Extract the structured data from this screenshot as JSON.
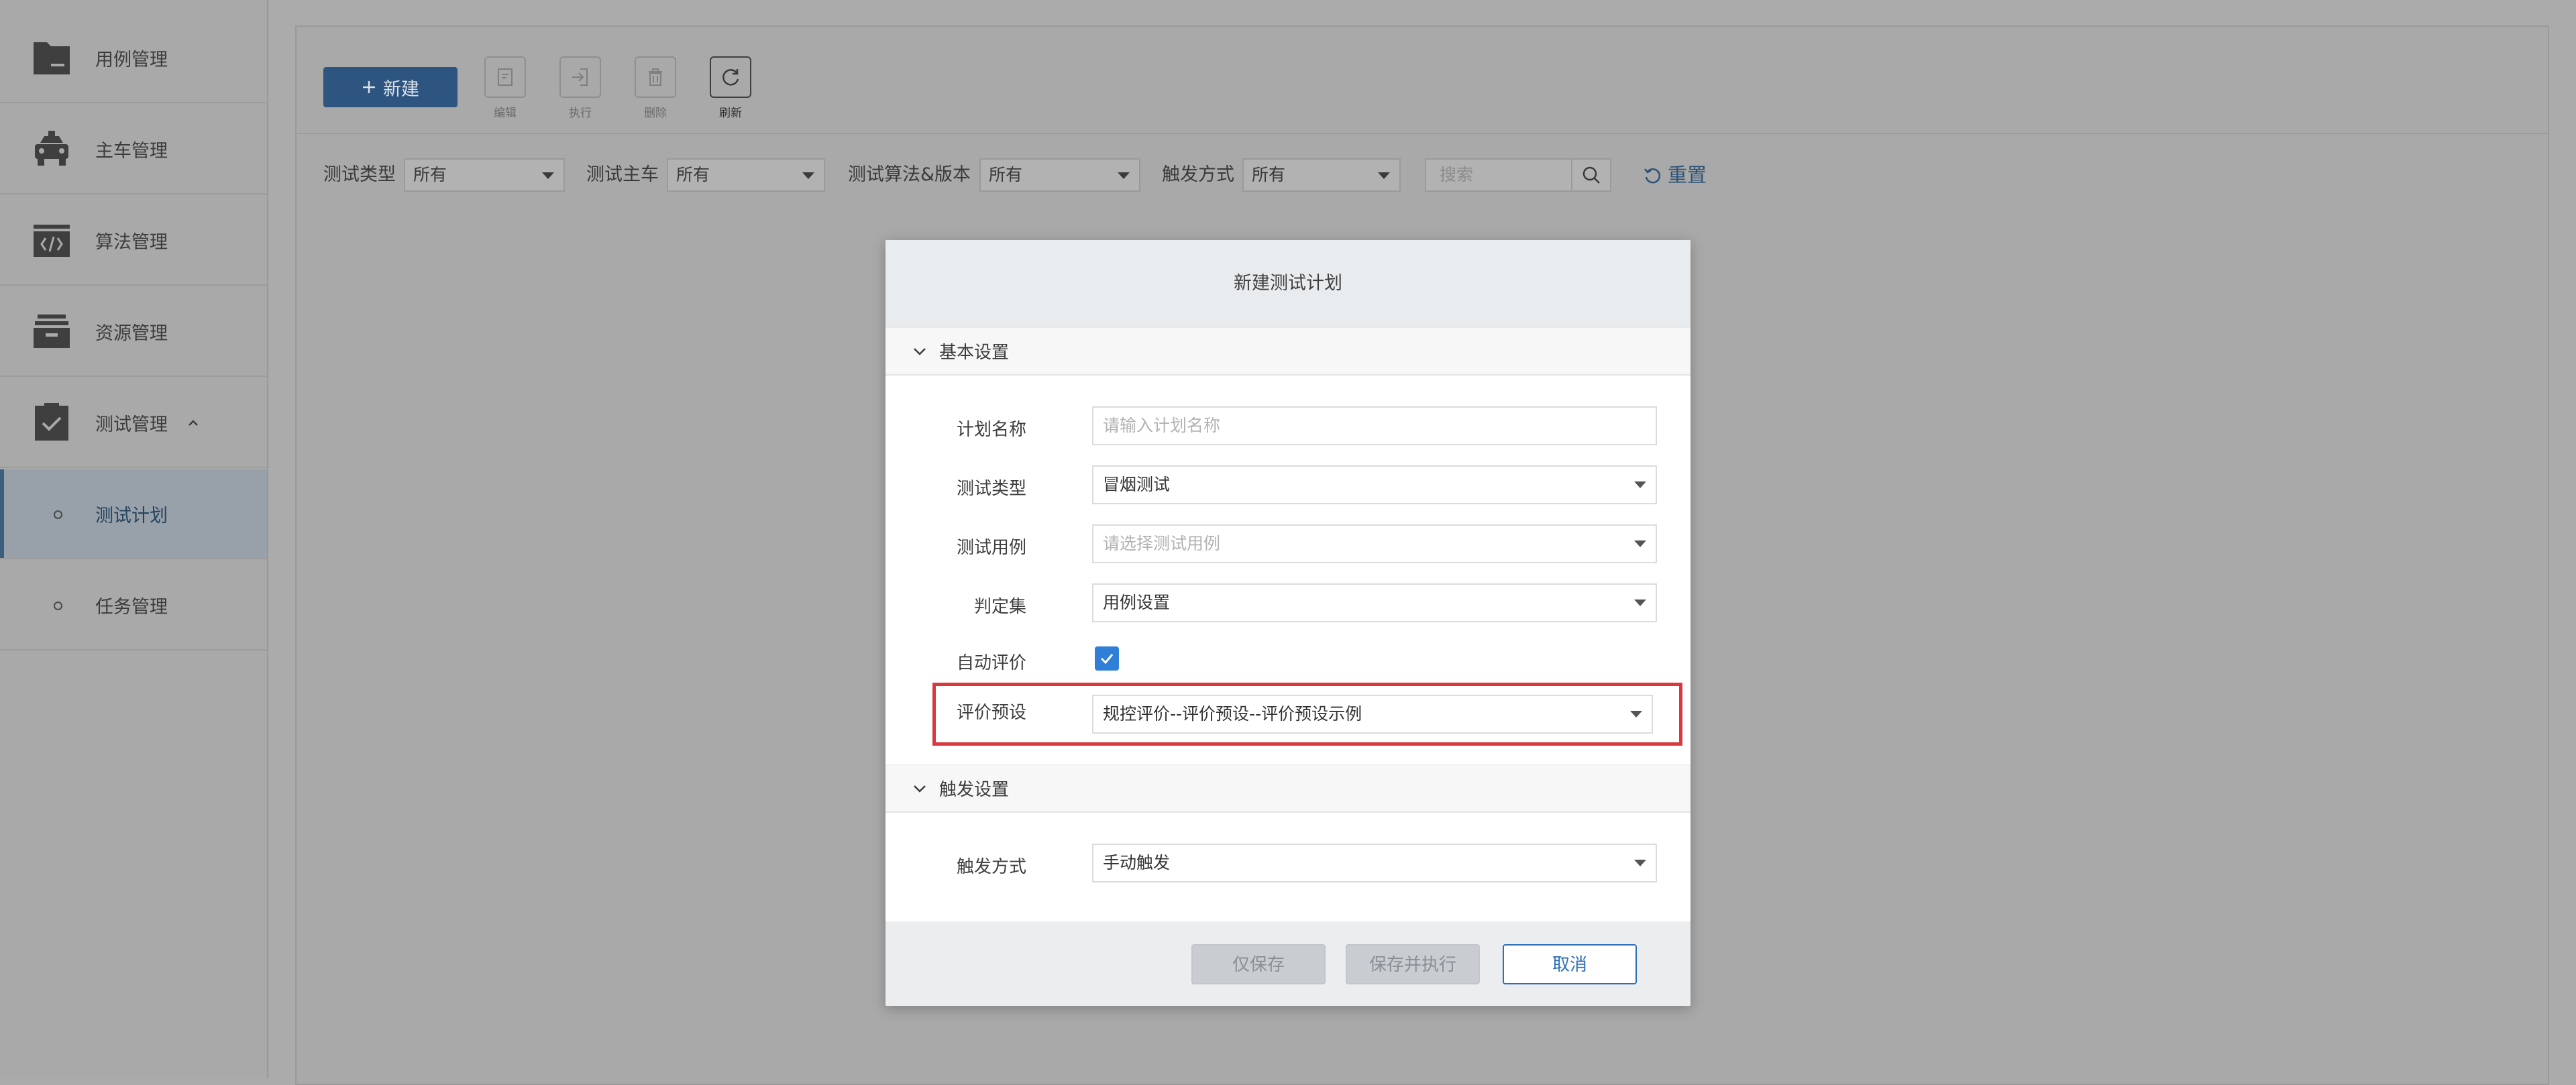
{
  "sidebar": {
    "items": [
      {
        "label": "用例管理",
        "icon": "folder-icon"
      },
      {
        "label": "主车管理",
        "icon": "car-icon"
      },
      {
        "label": "算法管理",
        "icon": "code-icon"
      },
      {
        "label": "资源管理",
        "icon": "archive-icon"
      },
      {
        "label": "测试管理",
        "icon": "clipboard-check-icon",
        "expanded": true
      }
    ],
    "subitems": [
      {
        "label": "测试计划",
        "active": true
      },
      {
        "label": "任务管理",
        "active": false
      }
    ]
  },
  "toolbar": {
    "new_label": "新建",
    "tools": [
      {
        "label": "编辑",
        "icon": "edit-icon"
      },
      {
        "label": "执行",
        "icon": "execute-icon"
      },
      {
        "label": "删除",
        "icon": "trash-icon"
      },
      {
        "label": "刷新",
        "icon": "refresh-icon"
      }
    ]
  },
  "filters": {
    "test_type": {
      "label": "测试类型",
      "value": "所有"
    },
    "test_vehicle": {
      "label": "测试主车",
      "value": "所有"
    },
    "algorithm": {
      "label": "测试算法&版本",
      "value": "所有"
    },
    "trigger": {
      "label": "触发方式",
      "value": "所有"
    },
    "search_placeholder": "搜索",
    "reset_label": "重置"
  },
  "modal": {
    "title": "新建测试计划",
    "basic_section": "基本设置",
    "fields": {
      "plan_name": {
        "label": "计划名称",
        "placeholder": "请输入计划名称"
      },
      "test_type": {
        "label": "测试类型",
        "value": "冒烟测试"
      },
      "test_case": {
        "label": "测试用例",
        "placeholder": "请选择测试用例"
      },
      "judge_set": {
        "label": "判定集",
        "value": "用例设置"
      },
      "auto_eval": {
        "label": "自动评价",
        "checked": true
      },
      "eval_preset": {
        "label": "评价预设",
        "value": "规控评价--评价预设--评价预设示例"
      }
    },
    "trigger_section": "触发设置",
    "trigger": {
      "label": "触发方式",
      "value": "手动触发"
    },
    "buttons": {
      "save_only": "仅保存",
      "save_execute": "保存并执行",
      "cancel": "取消"
    }
  },
  "colors": {
    "accent": "#2f7fd8",
    "highlight": "#d9393e",
    "primary_button": "#2d5580"
  }
}
